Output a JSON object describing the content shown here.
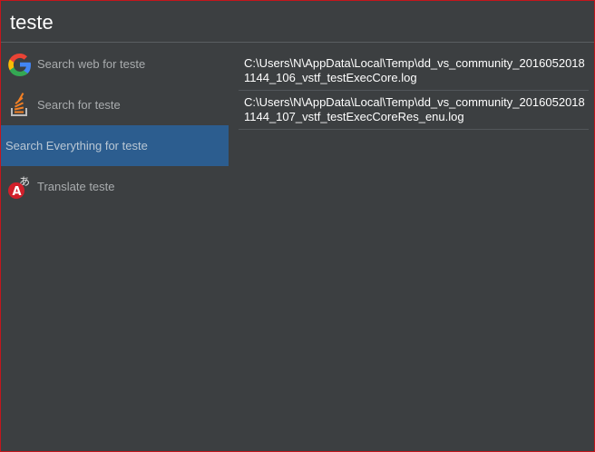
{
  "search": {
    "query": "teste"
  },
  "commands": [
    {
      "label": "Search web for teste",
      "icon": "google-icon",
      "selected": false
    },
    {
      "label": "Search for teste",
      "icon": "stackoverflow-icon",
      "selected": false
    },
    {
      "label": "Search Everything for teste",
      "icon": "",
      "selected": true
    },
    {
      "label": "Translate teste",
      "icon": "translate-icon",
      "selected": false
    }
  ],
  "results": [
    {
      "path": "C:\\Users\\N\\AppData\\Local\\Temp\\dd_vs_community_20160520181144_106_vstf_testExecCore.log"
    },
    {
      "path": "C:\\Users\\N\\AppData\\Local\\Temp\\dd_vs_community_20160520181144_107_vstf_testExecCoreRes_enu.log"
    }
  ],
  "colors": {
    "background": "#3c3f41",
    "selection": "#2c5d8f",
    "border": "#c4161c"
  }
}
